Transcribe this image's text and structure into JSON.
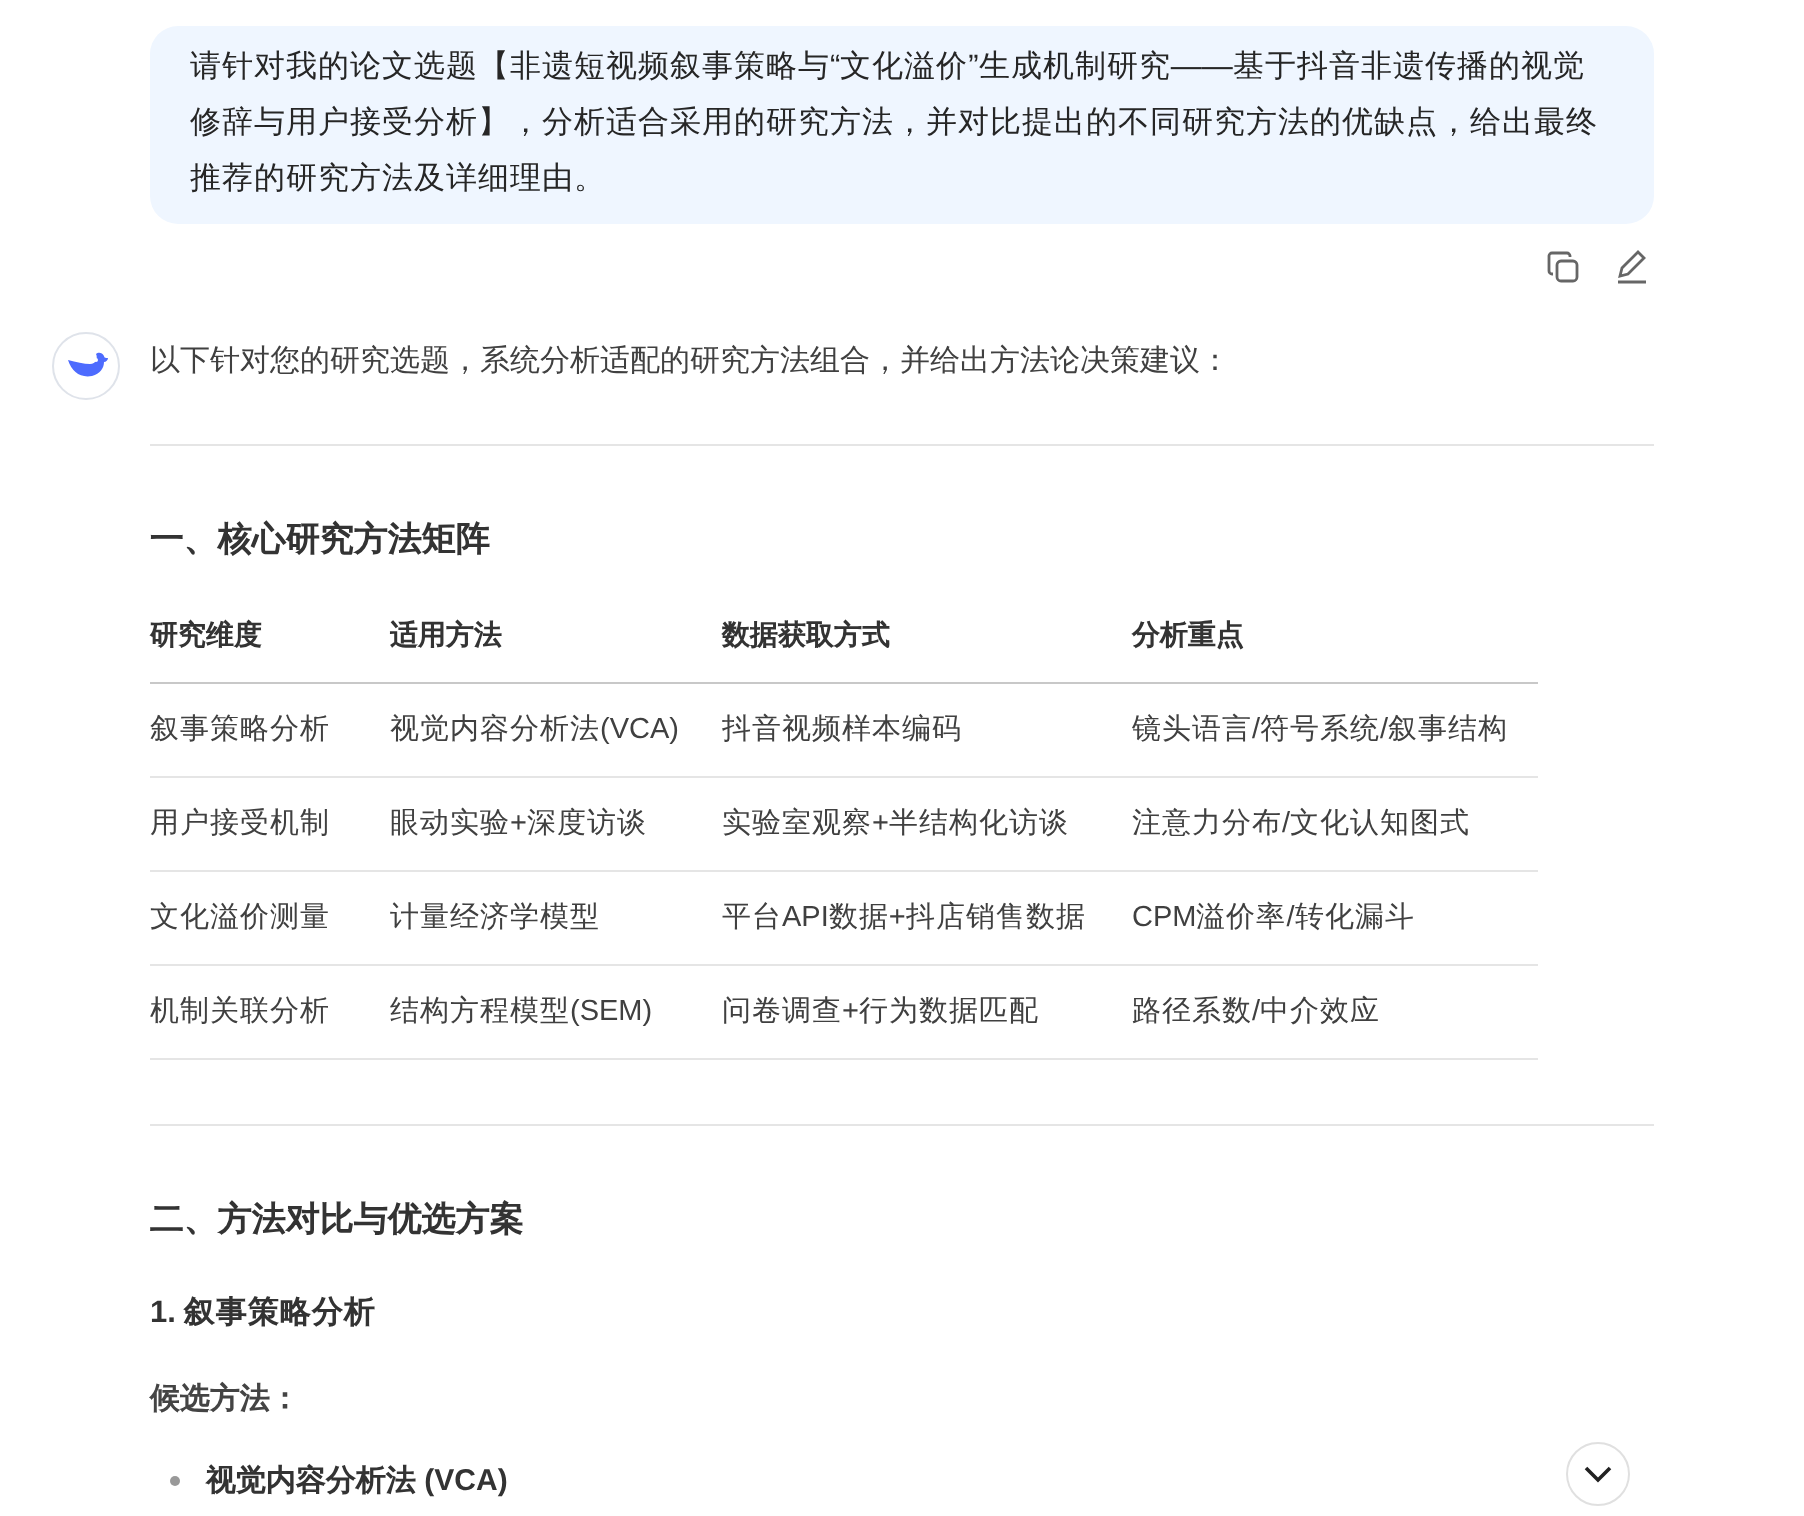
{
  "user_message": {
    "text": "请针对我的论文选题【非遗短视频叙事策略与“文化溢价”生成机制研究——基于抖音非遗传播的视觉修辞与用户接受分析】，分析适合采用的研究方法，并对比提出的不同研究方法的优缺点，给出最终推荐的研究方法及详细理由。"
  },
  "reply": {
    "intro": "以下针对您的研究选题，系统分析适配的研究方法组合，并给出方法论决策建议：",
    "section_1": {
      "heading": "一、核心研究方法矩阵",
      "table": {
        "columns": [
          "研究维度",
          "适用方法",
          "数据获取方式",
          "分析重点"
        ],
        "rows": [
          [
            "叙事策略分析",
            "视觉内容分析法(VCA)",
            "抖音视频样本编码",
            "镜头语言/符号系统/叙事结构"
          ],
          [
            "用户接受机制",
            "眼动实验+深度访谈",
            "实验室观察+半结构化访谈",
            "注意力分布/文化认知图式"
          ],
          [
            "文化溢价测量",
            "计量经济学模型",
            "平台API数据+抖店销售数据",
            "CPM溢价率/转化漏斗"
          ],
          [
            "机制关联分析",
            "结构方程模型(SEM)",
            "问卷调查+行为数据匹配",
            "路径系数/中介效应"
          ]
        ]
      }
    },
    "section_2": {
      "heading": "二、方法对比与优选方案",
      "subheading": "1. 叙事策略分析",
      "label": "候选方法：",
      "bullets": [
        "视觉内容分析法 (VCA)"
      ]
    }
  }
}
